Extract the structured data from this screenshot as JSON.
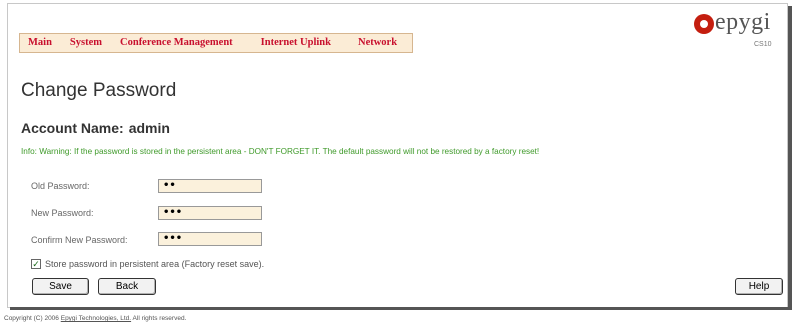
{
  "menu": {
    "items": [
      "Main",
      "System",
      "Conference Management",
      "Internet Uplink",
      "Network"
    ]
  },
  "logo": {
    "text": "epygi",
    "model": "CS10"
  },
  "page": {
    "title": "Change Password"
  },
  "account": {
    "label": "Account Name:",
    "value": "admin"
  },
  "info": "Info: Warning: If the password is stored in the persistent area - DON'T FORGET IT. The default password will not be restored by a factory reset!",
  "form": {
    "old_password_label": "Old Password:",
    "old_password_value": "••",
    "new_password_label": "New Password:",
    "new_password_value": "•••",
    "confirm_password_label": "Confirm New Password:",
    "confirm_password_value": "•••",
    "store_label": "Store password in persistent area (Factory reset save).",
    "store_checked": true
  },
  "buttons": {
    "save": "Save",
    "back": "Back",
    "help": "Help"
  },
  "footer": {
    "prefix": "Copyright (C) 2006",
    "link": "Epygi Technologies, Ltd.",
    "suffix": "All rights reserved."
  },
  "colors": {
    "menu_text": "#c8102e",
    "menu_bg": "#fbecd6",
    "info_text": "#3f9a2a",
    "field_bg": "#fbf1dc",
    "logo_red": "#c41e0f"
  }
}
